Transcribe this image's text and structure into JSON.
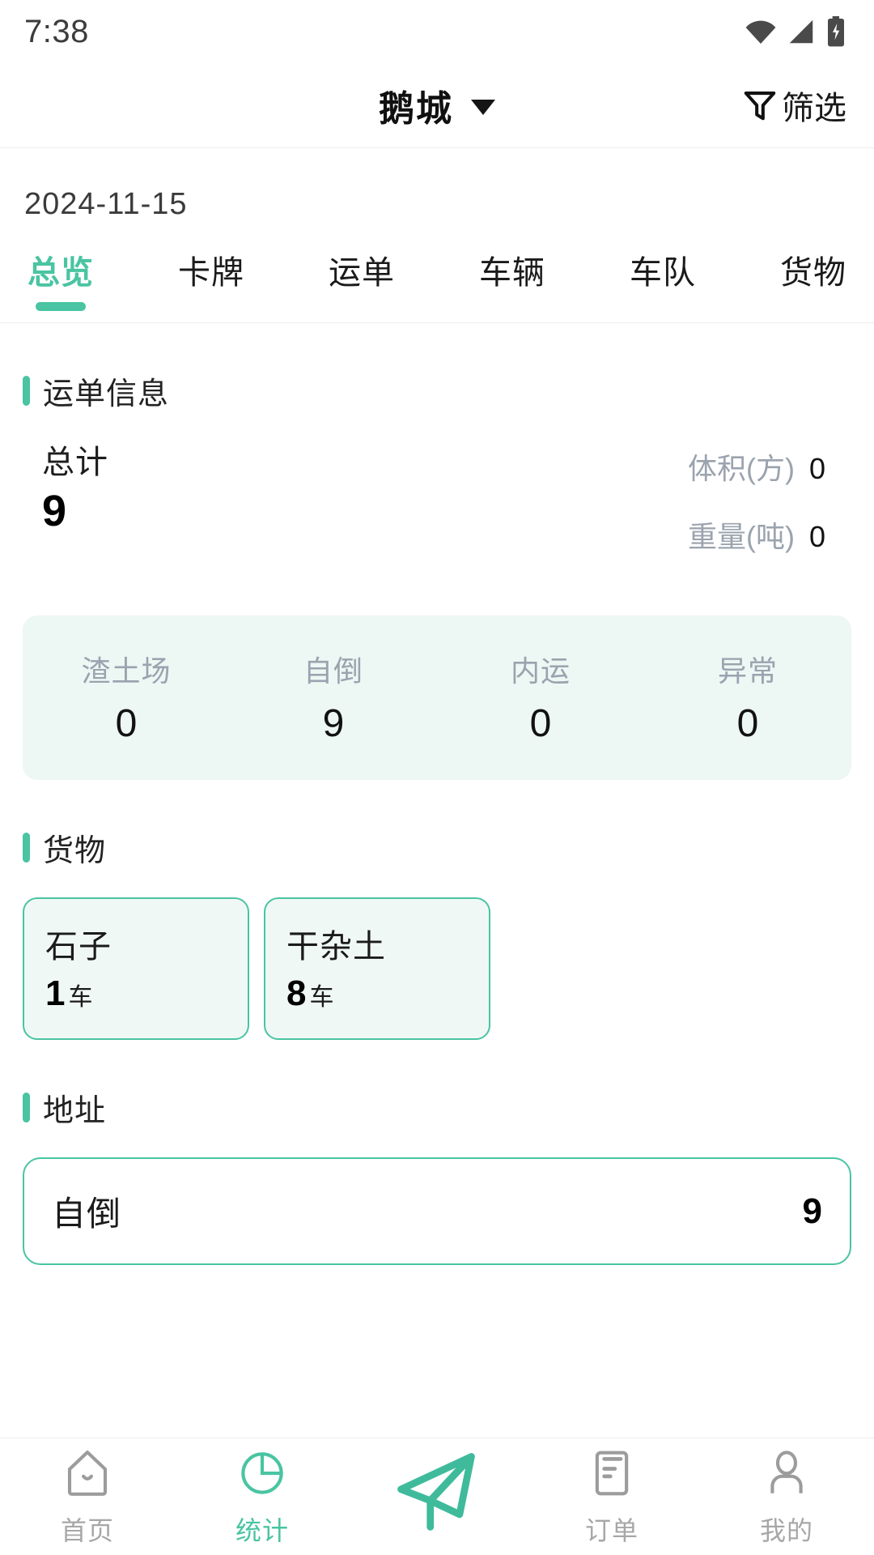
{
  "statusbar": {
    "time": "7:38",
    "icons": [
      "wifi-icon",
      "cellular-signal-icon",
      "battery-charging-icon"
    ]
  },
  "header": {
    "title": "鹅城",
    "dropdown_icon": "chevron-down-icon",
    "filter_label": "筛选",
    "filter_icon": "funnel-icon"
  },
  "date": "2024-11-15",
  "tabs": [
    {
      "label": "总览",
      "active": true
    },
    {
      "label": "卡牌",
      "active": false
    },
    {
      "label": "运单",
      "active": false
    },
    {
      "label": "车辆",
      "active": false
    },
    {
      "label": "车队",
      "active": false
    },
    {
      "label": "货物",
      "active": false
    }
  ],
  "waybill": {
    "section_title": "运单信息",
    "total_label": "总计",
    "total_value": "9",
    "metrics": [
      {
        "label": "体积(方)",
        "value": "0"
      },
      {
        "label": "重量(吨)",
        "value": "0"
      }
    ],
    "stats": [
      {
        "label": "渣土场",
        "value": "0"
      },
      {
        "label": "自倒",
        "value": "9"
      },
      {
        "label": "内运",
        "value": "0"
      },
      {
        "label": "异常",
        "value": "0"
      }
    ]
  },
  "cargo": {
    "section_title": "货物",
    "items": [
      {
        "name": "石子",
        "count": "1",
        "unit": "车"
      },
      {
        "name": "干杂土",
        "count": "8",
        "unit": "车"
      }
    ]
  },
  "address": {
    "section_title": "地址",
    "items": [
      {
        "name": "自倒",
        "count": "9"
      }
    ]
  },
  "bottomnav": [
    {
      "label": "首页",
      "icon": "home-icon",
      "active": false
    },
    {
      "label": "统计",
      "icon": "pie-chart-icon",
      "active": true
    },
    {
      "label": "",
      "icon": "paper-plane-icon",
      "active": false
    },
    {
      "label": "订单",
      "icon": "order-list-icon",
      "active": false
    },
    {
      "label": "我的",
      "icon": "user-profile-icon",
      "active": false
    }
  ],
  "colors": {
    "accent": "#4ac4a2",
    "card_mint": "#edf7f4",
    "muted_text": "#9aa3ae"
  }
}
